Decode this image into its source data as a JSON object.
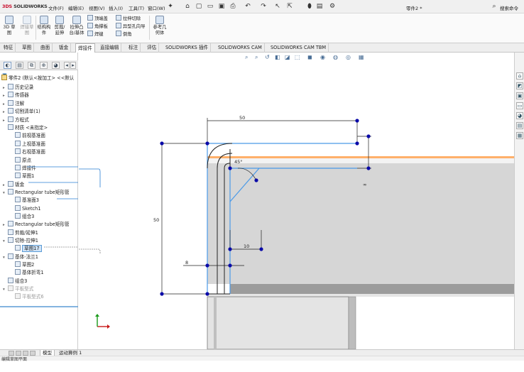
{
  "app": {
    "brand_prefix": "3DS",
    "brand": "SOLIDWORKS",
    "doc_title": "零件2 *",
    "search_placeholder": "搜索命令"
  },
  "menu": [
    "文件(F)",
    "编辑(E)",
    "视图(V)",
    "插入(I)",
    "工具(T)",
    "窗口(W)"
  ],
  "ribbon": {
    "sketch3d": "3D 草图",
    "weld_sketch": "焊接草图",
    "struct": "结构构件",
    "trim": "剪裁/延伸",
    "boss": "拉伸凸台/基体",
    "end_cap": "顶端盖",
    "gusset": "角撑板",
    "weld_bead": "焊缝",
    "cut_extrude": "拉伸切除",
    "hole_wizard": "异型孔向导",
    "chamfer": "倒角",
    "ref_geom": "参考几何体"
  },
  "tabs": [
    "特征",
    "草图",
    "曲面",
    "钣金",
    "焊接件",
    "直接编辑",
    "标注",
    "评估",
    "SOLIDWORKS 插件",
    "SOLIDWORKS CAM",
    "SOLIDWORKS CAM TBM"
  ],
  "active_tab_index": 4,
  "tree": {
    "root": "零件2 (默认<按加工> <<默认",
    "items": [
      {
        "label": "历史记录"
      },
      {
        "label": "传感器"
      },
      {
        "label": "注解"
      },
      {
        "label": "切割清单(1)"
      },
      {
        "label": "方程式"
      },
      {
        "label": "材质 <未指定>"
      },
      {
        "label": "前视基准面"
      },
      {
        "label": "上视基准面"
      },
      {
        "label": "右视基准面"
      },
      {
        "label": "原点"
      },
      {
        "label": "焊接件"
      },
      {
        "label": "草图1"
      },
      {
        "label": "钣金"
      },
      {
        "label": "Rectangular tube矩形管"
      },
      {
        "label": "基准面3"
      },
      {
        "label": "Sketch1"
      },
      {
        "label": "组合3"
      },
      {
        "label": "Rectangular tube矩形管"
      },
      {
        "label": "剪裁/延伸1"
      },
      {
        "label": "切除-拉伸1"
      },
      {
        "label": "草图17"
      },
      {
        "label": "基体-法兰1"
      },
      {
        "label": "草图2"
      },
      {
        "label": "基体折弯1"
      },
      {
        "label": "组合3"
      },
      {
        "label": "平板型式"
      },
      {
        "label": "平板型式6"
      }
    ]
  },
  "dimensions": {
    "top": "50",
    "left": "50",
    "angle": "45°",
    "ten": "10",
    "eight": "8",
    "right": "∞"
  },
  "bottom_tabs": [
    "模型",
    "运动算例 1"
  ],
  "status": "编辑草图平面",
  "colors": {
    "accent": "#0a0aa8",
    "sketch_line": "#4a9ae8",
    "brand_red": "#c8102e"
  }
}
